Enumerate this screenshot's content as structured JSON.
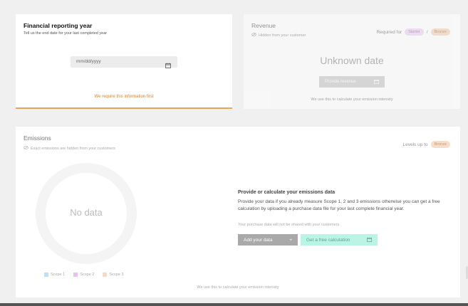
{
  "financial_year": {
    "title": "Financial reporting year",
    "subtitle": "Tell us the end date for your last completed year",
    "date_placeholder": "mm/dd/yyyy",
    "warning": "We require this information first"
  },
  "revenue": {
    "title": "Revenue",
    "hidden_note": "Hidden from your customer",
    "required_label": "Required for",
    "badge_starter": "Starter",
    "separator": "/",
    "badge_bronze": "Bronze",
    "value": "Unknown date",
    "provide_button": "Provide revenue",
    "use_note": "We use this to calculate your emission intensity"
  },
  "emissions": {
    "title": "Emissions",
    "hidden_note": "Exact emissions are hidden from your customers",
    "levels_label": "Levels up to",
    "badge_bronze": "Bronze",
    "no_data": "No data",
    "legend": [
      {
        "label": "Scope 1",
        "color": "#bfe0f2"
      },
      {
        "label": "Scope 2",
        "color": "#e6c3ef"
      },
      {
        "label": "Scope 3",
        "color": "#f6dcc4"
      }
    ],
    "provide_title": "Provide or calculate your emissions data",
    "provide_desc": "Provide your data if you already measure Scope 1, 2 and 3 emissions otherwise you can get a free calculation by uploading a purchase data file for your last complete financial year.",
    "purchase_note": "Your purchase data will not be shared with your customers",
    "add_button": "Add your data",
    "add_icon": "+",
    "calc_button": "Get a free calculation",
    "use_note": "We use this to calculate your emission intensity"
  }
}
